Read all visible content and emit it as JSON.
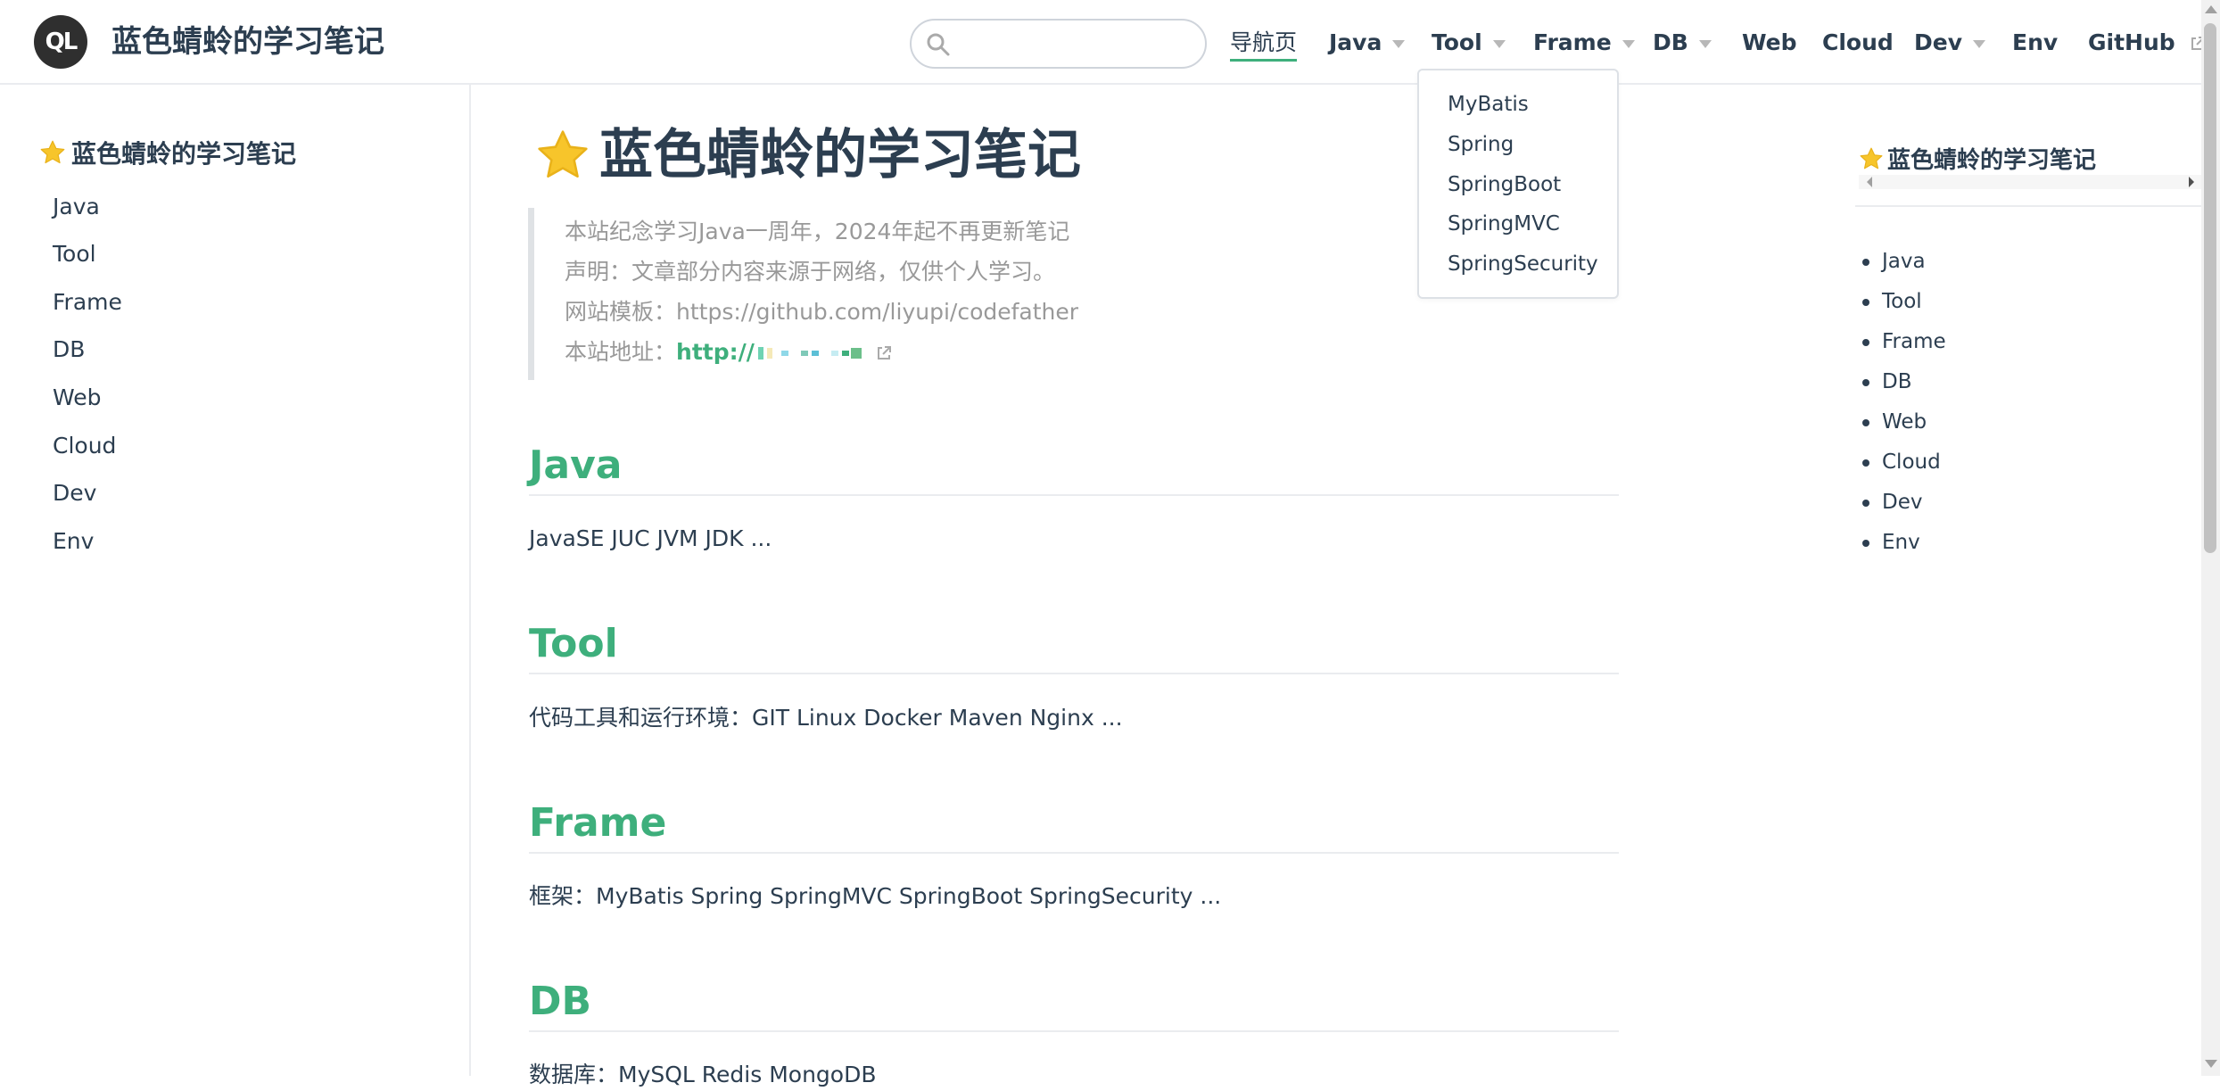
{
  "header": {
    "logo_text": "QL",
    "site_name": "蓝色蜻蛉的学习笔记",
    "search_placeholder": "",
    "nav": [
      {
        "label": "导航页"
      },
      {
        "label": "Java"
      },
      {
        "label": "Tool"
      },
      {
        "label": "Frame"
      },
      {
        "label": "DB"
      },
      {
        "label": "Web"
      },
      {
        "label": "Cloud"
      },
      {
        "label": "Dev"
      },
      {
        "label": "Env"
      },
      {
        "label": "GitHub"
      }
    ],
    "dropdown": [
      "MyBatis",
      "Spring",
      "SpringBoot",
      "SpringMVC",
      "SpringSecurity"
    ]
  },
  "sidebar": {
    "title": "蓝色蜻蛉的学习笔记",
    "items": [
      "Java",
      "Tool",
      "Frame",
      "DB",
      "Web",
      "Cloud",
      "Dev",
      "Env"
    ]
  },
  "main": {
    "title": "蓝色蜻蛉的学习笔记",
    "quote": {
      "line1": "本站纪念学习Java一周年，2024年起不再更新笔记",
      "line2": "声明：文章部分内容来源于网络，仅供个人学习。",
      "line3": "网站模板：https://github.com/liyupi/codefather",
      "line4_label": "本站地址：",
      "line4_link": "http://"
    },
    "sections": [
      {
        "heading": "Java",
        "text": "JavaSE JUC JVM JDK ..."
      },
      {
        "heading": "Tool",
        "text": "代码工具和运行环境：GIT Linux Docker Maven Nginx ..."
      },
      {
        "heading": "Frame",
        "text": "框架：MyBatis Spring SpringMVC SpringBoot SpringSecurity ..."
      },
      {
        "heading": "DB",
        "text": "数据库：MySQL Redis MongoDB"
      }
    ]
  },
  "toc": {
    "title": "蓝色蜻蛉的学习笔记",
    "items": [
      "Java",
      "Tool",
      "Frame",
      "DB",
      "Web",
      "Cloud",
      "Dev",
      "Env"
    ]
  },
  "colors": {
    "accent": "#3eaf7c",
    "text": "#2c3e50",
    "muted": "#999999",
    "star": "#f7c52b"
  },
  "icons": [
    "search-icon",
    "star-icon",
    "external-link-icon",
    "chevron-down-icon"
  ]
}
